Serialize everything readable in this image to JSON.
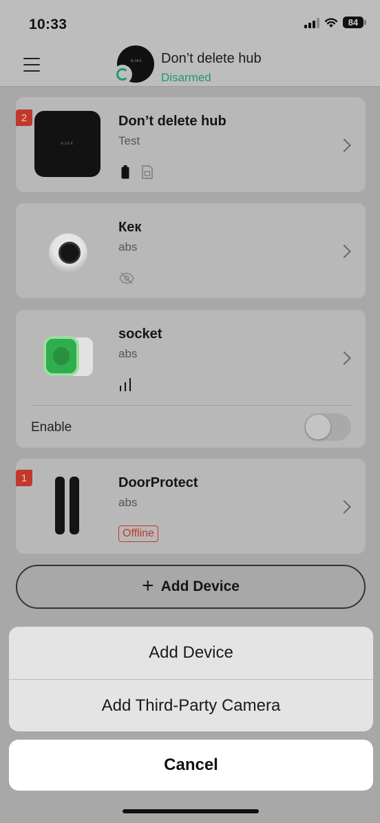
{
  "status_bar": {
    "time": "10:33",
    "battery": "84"
  },
  "header": {
    "hub_name": "Don’t delete hub",
    "hub_state": "Disarmed"
  },
  "devices": [
    {
      "name": "Don’t delete hub",
      "room": "Test",
      "badge": "2"
    },
    {
      "name": "Кек",
      "room": "abs"
    },
    {
      "name": "socket",
      "room": "abs",
      "enable_label": "Enable"
    },
    {
      "name": "DoorProtect",
      "room": "abs",
      "badge": "1",
      "status": "Offline"
    }
  ],
  "add_device_button": "Add Device",
  "action_sheet": {
    "options": [
      "Add Device",
      "Add Third-Party Camera"
    ],
    "cancel": "Cancel"
  },
  "colors": {
    "accent_green": "#1e9a6e",
    "alert_red": "#c0392b"
  }
}
